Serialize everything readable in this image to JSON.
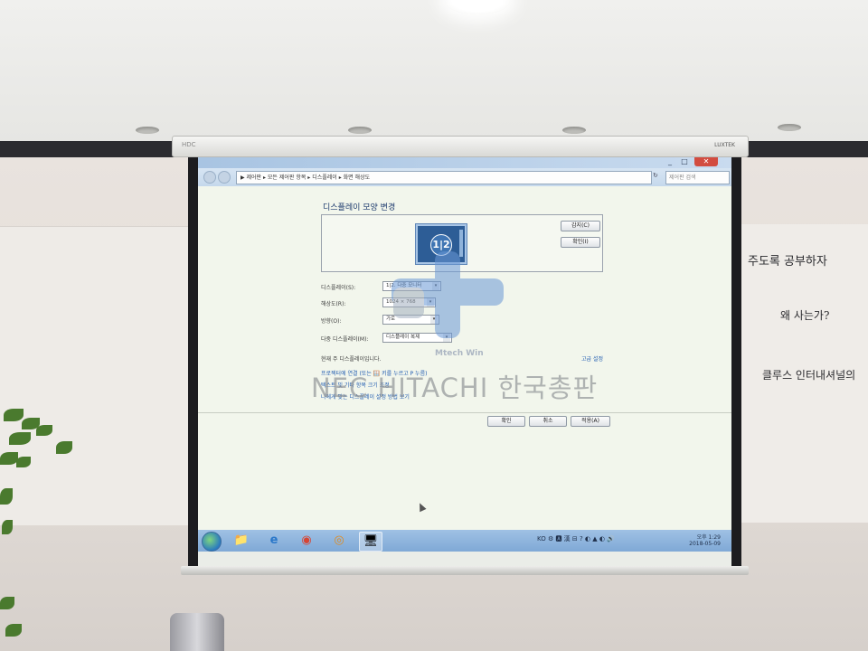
{
  "room": {
    "housing_brand": "HDC",
    "housing_logo": "LUXTEK",
    "whiteboard_lines": [
      "주도록 공부하자",
      "왜 사는가?",
      "클루스 인터내셔널의"
    ]
  },
  "window": {
    "title": "",
    "controls": [
      "_",
      "□",
      "✕"
    ],
    "breadcrumb": "▶ 제어판 ▸ 모든 제어판 항목 ▸ 디스플레이 ▸ 화면 해상도",
    "search_placeholder": "제어판 검색"
  },
  "page": {
    "title": "디스플레이 모양 변경",
    "monitor_number": "1|2",
    "detect_button": "감지(C)",
    "identify_button": "확인(I)",
    "display_label": "디스플레이(S):",
    "display_value": "1|2. 다중 모니터",
    "resolution_label": "해상도(R):",
    "resolution_value": "1024 × 768",
    "orientation_label": "방향(O):",
    "orientation_value": "가로",
    "multi_label": "다중 디스플레이(M):",
    "multi_value": "디스플레이 복제",
    "main_display_text": "현재 주 디스플레이입니다.",
    "advanced_link": "고급 설정",
    "link_1": "프로젝터에 연결 (또는 🪟 키를 누르고 P 누름)",
    "link_2": "텍스트 및 기타 항목 크기 조정",
    "link_3": "나에게 맞는 디스플레이 설정 방법 보기",
    "ok_button": "확인",
    "cancel_button": "취소",
    "apply_button": "적용(A)"
  },
  "watermark": {
    "text": "NEC HITACHI 한국총판",
    "small": "Mtech Win"
  },
  "taskbar": {
    "icons": [
      "📁",
      "e",
      "◉",
      "◎",
      "🖥"
    ],
    "tray": "KO ⚙ 🅰 漢 ⊟ ? ◐ ▲ ◐ 🔊",
    "time": "오후 1:29",
    "date": "2018-05-09"
  }
}
